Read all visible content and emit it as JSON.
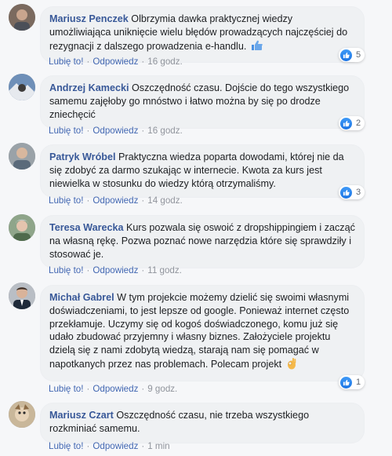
{
  "actions": {
    "like_label": "Lubię to!",
    "reply_label": "Odpowiedz",
    "separator": "·"
  },
  "comments": [
    {
      "author": "Mariusz Penczek",
      "text": "Olbrzymia dawka praktycznej wiedzy umożliwiająca uniknięcie wielu błędów prowadzących najczęściej do rezygnacji z dalszego prowadzenia e-handlu.",
      "emoji": "thumbs-up-emoji",
      "time": "16 godz.",
      "likes": "5"
    },
    {
      "author": "Andrzej Kamecki",
      "text": "Oszczędność czasu. Dojście do tego wszystkiego samemu zajęłoby go mnóstwo i łatwo można by się po drodze zniechęcić",
      "time": "16 godz.",
      "likes": "2"
    },
    {
      "author": "Patryk Wróbel",
      "text": "Praktyczna wiedza poparta dowodami, której nie da się zdobyć za darmo szukając w internecie. Kwota za kurs jest niewielka w stosunku do wiedzy którą otrzymaliśmy.",
      "time": "14 godz.",
      "likes": "3"
    },
    {
      "author": "Teresa Warecka",
      "text": "Kurs pozwala się oswoić z dropshippingiem i zacząć na własną rękę. Pozwa poznać nowe narzędzia które się sprawdziły i stosować je.",
      "time": "11 godz."
    },
    {
      "author": "Michał Gabrel",
      "text": "W tym projekcie możemy dzielić się swoimi własnymi doświadczeniami, to jest lepsze od google. Ponieważ internet często przekłamuje. Uczymy się od kogoś doświadczonego, komu już się udało zbudować przyjemny i własny biznes. Założyciele projektu dzielą się z nami zdobytą wiedzą, starają nam się pomagać w napotkanych przez nas problemach. Polecam projekt",
      "emoji": "ok-hand-emoji",
      "time": "9 godz.",
      "likes": "1"
    },
    {
      "author": "Mariusz Czart",
      "text": "Oszczędność czasu, nie trzeba wszystkiego rozkminiać samemu.",
      "time": "1 min"
    }
  ],
  "colors": {
    "author": "#385898",
    "link": "#4267b2",
    "bubble": "#eff1f3",
    "like": "#1b74e4"
  }
}
